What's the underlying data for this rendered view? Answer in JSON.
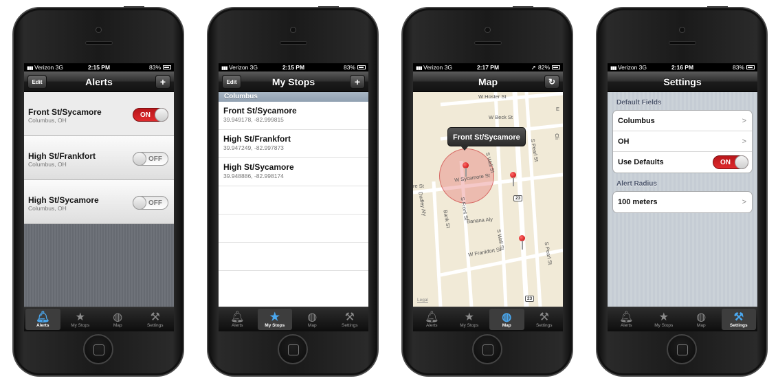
{
  "colors": {
    "switch_on": "#d22124",
    "tab_active_icon": "#4aa8f0",
    "navbar": "#2e2e2e"
  },
  "tab_bar": [
    {
      "label": "Alerts",
      "icon": "bell-icon"
    },
    {
      "label": "My Stops",
      "icon": "star-icon"
    },
    {
      "label": "Map",
      "icon": "globe-icon"
    },
    {
      "label": "Settings",
      "icon": "wrench-icon"
    }
  ],
  "phones": [
    {
      "status": {
        "carrier": "Verizon",
        "network": "3G",
        "time": "2:15 PM",
        "battery": "83%"
      },
      "nav": {
        "title": "Alerts",
        "left_button": "Edit",
        "right_button": "+"
      },
      "active_tab": 0,
      "alerts": [
        {
          "title": "Front St/Sycamore",
          "subtitle": "Columbus, OH",
          "toggle": "ON"
        },
        {
          "title": "High St/Frankfort",
          "subtitle": "Columbus, OH",
          "toggle": "OFF"
        },
        {
          "title": "High St/Sycamore",
          "subtitle": "Columbus, OH",
          "toggle": "OFF"
        }
      ]
    },
    {
      "status": {
        "carrier": "Verizon",
        "network": "3G",
        "time": "2:15 PM",
        "battery": "83%"
      },
      "nav": {
        "title": "My Stops",
        "left_button": "Edit",
        "right_button": "+"
      },
      "active_tab": 1,
      "section": "Columbus",
      "stops": [
        {
          "title": "Front St/Sycamore",
          "coords": "39.949178, -82.999815"
        },
        {
          "title": "High St/Frankfort",
          "coords": "39.947249, -82.997873"
        },
        {
          "title": "High St/Sycamore",
          "coords": "39.948886, -82.998174"
        }
      ]
    },
    {
      "status": {
        "carrier": "Verizon",
        "network": "3G",
        "time": "2:17 PM",
        "battery": "82%"
      },
      "nav": {
        "title": "Map",
        "right_button": "↻"
      },
      "active_tab": 2,
      "map": {
        "callout": "Front St/Sycamore",
        "streets": {
          "hoster": "W Hoster St",
          "beck": "W Beck St",
          "sycamore": "W Sycamore St",
          "sycamore_left": "re St",
          "frankfort": "W Frankfort St",
          "front": "S Front St",
          "wall": "S Wall St",
          "wall_lower": "S Wall St",
          "pearl": "S Pearl St",
          "pearl_lower": "S Pearl St",
          "dudley": "Dudley Aly",
          "bank": "Bank St",
          "banana": "Banana Aly",
          "edge_e": "E",
          "edge_cli": "Cli"
        },
        "route_shields": [
          "23",
          "23"
        ],
        "legal": "Legal"
      }
    },
    {
      "status": {
        "carrier": "Verizon",
        "network": "3G",
        "time": "2:16 PM",
        "battery": "83%"
      },
      "nav": {
        "title": "Settings"
      },
      "active_tab": 3,
      "settings": {
        "default_fields_header": "Default Fields",
        "city": "Columbus",
        "state": "OH",
        "use_defaults_label": "Use Defaults",
        "use_defaults_toggle": "ON",
        "alert_radius_header": "Alert Radius",
        "alert_radius": "100 meters"
      }
    }
  ]
}
